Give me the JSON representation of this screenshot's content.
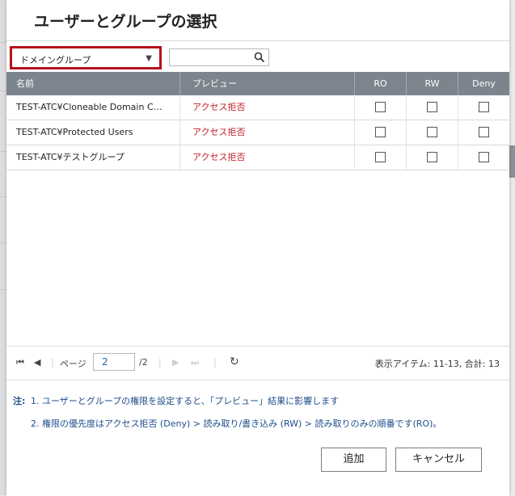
{
  "dialog": {
    "title": "ユーザーとグループの選択"
  },
  "filter": {
    "domain_select_value": "ドメイングループ",
    "search_value": ""
  },
  "table": {
    "headers": {
      "name": "名前",
      "preview": "プレビュー",
      "ro": "RO",
      "rw": "RW",
      "deny": "Deny"
    },
    "rows": [
      {
        "name": "TEST-ATC¥Cloneable Domain C…",
        "preview": "アクセス拒否"
      },
      {
        "name": "TEST-ATC¥Protected Users",
        "preview": "アクセス拒否"
      },
      {
        "name": "TEST-ATC¥テストグループ",
        "preview": "アクセス拒否"
      }
    ]
  },
  "pager": {
    "page_label": "ページ",
    "current_page": "2",
    "total_pages": "/2",
    "info": "表示アイテム: 11-13, 合計: 13"
  },
  "notes": {
    "label": "注:",
    "line1": "1. ユーザーとグループの権限を設定すると、「プレビュー」結果に影響します",
    "line2": "2. 権限の優先度はアクセス拒否 (Deny) > 読み取り/書き込み (RW) > 読み取りのみの順番です(RO)。"
  },
  "buttons": {
    "add": "追加",
    "cancel": "キャンセル"
  },
  "colors": {
    "header_bg": "#7c858e",
    "highlight_border": "#b5121b",
    "deny_text": "#c3212b",
    "note_text": "#1d4d8a"
  }
}
